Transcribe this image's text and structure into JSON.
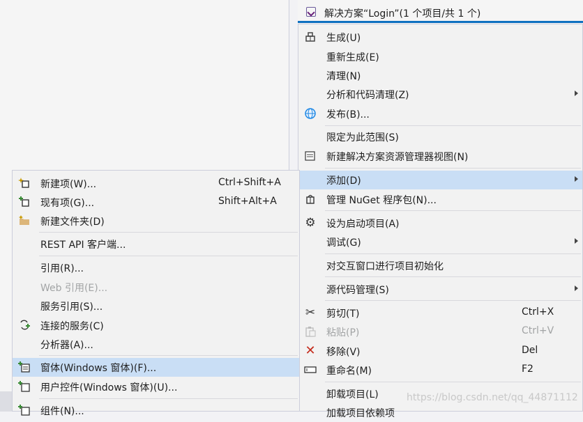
{
  "explorer": {
    "solution_label": "解决方案“Login”(1 个项目/共 1 个)"
  },
  "main_menu": [
    {
      "label": "生成(U)",
      "icon": "build-icon"
    },
    {
      "label": "重新生成(E)"
    },
    {
      "label": "清理(N)"
    },
    {
      "label": "分析和代码清理(Z)",
      "submenu": true
    },
    {
      "label": "发布(B)...",
      "icon": "globe-icon"
    },
    {
      "label": "限定为此范围(S)"
    },
    {
      "label": "新建解决方案资源管理器视图(N)",
      "icon": "new-view-icon"
    },
    {
      "label": "添加(D)",
      "submenu": true,
      "selected": true
    },
    {
      "label": "管理 NuGet 程序包(N)...",
      "icon": "nuget-icon"
    },
    {
      "label": "设为启动项目(A)",
      "icon": "gear-icon"
    },
    {
      "label": "调试(G)",
      "submenu": true
    },
    {
      "label": "对交互窗口进行项目初始化"
    },
    {
      "label": "源代码管理(S)",
      "submenu": true
    },
    {
      "label": "剪切(T)",
      "shortcut": "Ctrl+X",
      "icon": "scissors-icon"
    },
    {
      "label": "粘贴(P)",
      "shortcut": "Ctrl+V",
      "icon": "paste-icon",
      "disabled": true
    },
    {
      "label": "移除(V)",
      "shortcut": "Del",
      "icon": "remove-icon"
    },
    {
      "label": "重命名(M)",
      "shortcut": "F2",
      "icon": "rename-icon"
    },
    {
      "label": "卸载项目(L)"
    },
    {
      "label": "加载项目依赖项"
    }
  ],
  "sub_menu": [
    {
      "label": "新建项(W)...",
      "shortcut": "Ctrl+Shift+A",
      "icon": "new-item-icon"
    },
    {
      "label": "现有项(G)...",
      "shortcut": "Shift+Alt+A",
      "icon": "existing-item-icon"
    },
    {
      "label": "新建文件夹(D)",
      "icon": "new-folder-icon"
    },
    {
      "label": "REST API 客户端..."
    },
    {
      "label": "引用(R)..."
    },
    {
      "label": "Web 引用(E)...",
      "disabled": true
    },
    {
      "label": "服务引用(S)..."
    },
    {
      "label": "连接的服务(C)",
      "icon": "connected-service-icon"
    },
    {
      "label": "分析器(A)..."
    },
    {
      "label": "窗体(Windows 窗体)(F)...",
      "icon": "form-icon",
      "selected": true
    },
    {
      "label": "用户控件(Windows 窗体)(U)...",
      "icon": "user-control-icon"
    },
    {
      "label": "组件(N)...",
      "icon": "component-icon"
    }
  ],
  "watermark": "https://blog.csdn.net/qq_44871112",
  "colors": {
    "selection": "#c9def5",
    "accent": "#0e70c0",
    "remove_red": "#c42b1c",
    "menu_bg": "#f2f2f2"
  }
}
